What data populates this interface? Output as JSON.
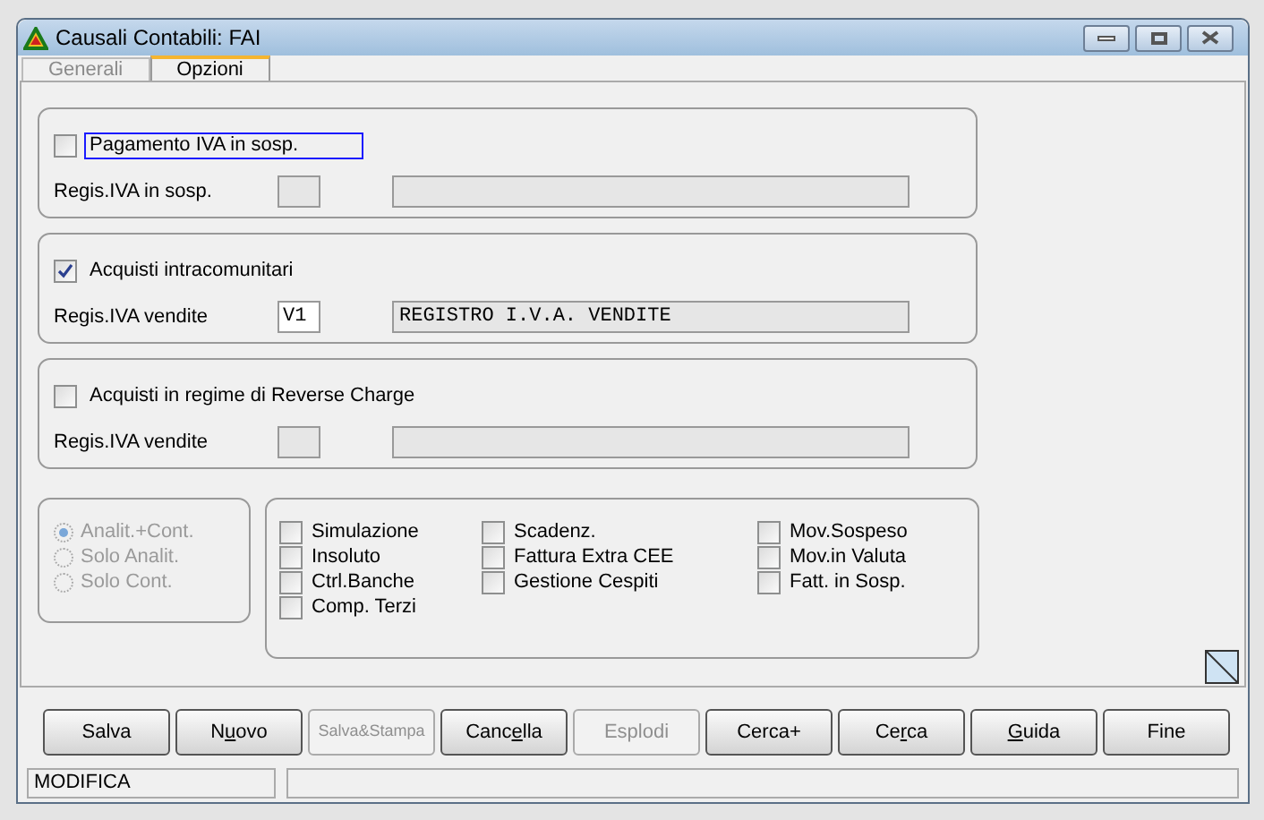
{
  "window": {
    "title": "Causali Contabili: FAI"
  },
  "tabs": [
    {
      "label": "Generali",
      "selected": false
    },
    {
      "label": "Opzioni",
      "selected": true
    }
  ],
  "sections": [
    {
      "option": {
        "label": "Pagamento IVA in sosp.",
        "checked": false,
        "focused": true
      },
      "register": {
        "label": "Regis.IVA in sosp.",
        "enabled": false
      }
    },
    {
      "option": {
        "label": "Acquisti intracomunitari",
        "checked": true,
        "focused": false
      },
      "register": {
        "label": "Regis.IVA vendite",
        "code": "V1",
        "description": "REGISTRO I.V.A. VENDITE",
        "enabled": true
      }
    },
    {
      "option": {
        "label": "Acquisti in regime di Reverse Charge",
        "checked": false,
        "focused": false
      },
      "register": {
        "label": "Regis.IVA vendite",
        "enabled": false
      }
    }
  ],
  "mode_radios": [
    {
      "label": "Analit.+Cont.",
      "selected": true,
      "disabled": true
    },
    {
      "label": "Solo Analit.",
      "selected": false,
      "disabled": true
    },
    {
      "label": "Solo Cont.",
      "selected": false,
      "disabled": true
    }
  ],
  "flag_columns": [
    [
      {
        "label": "Simulazione",
        "checked": false
      },
      {
        "label": "Insoluto",
        "checked": false
      },
      {
        "label": "Ctrl.Banche",
        "checked": false
      },
      {
        "label": "Comp. Terzi",
        "checked": false
      }
    ],
    [
      {
        "label": "Scadenz.",
        "checked": false
      },
      {
        "label": "Fattura Extra CEE",
        "checked": false
      },
      {
        "label": "Gestione Cespiti",
        "checked": false
      }
    ],
    [
      {
        "label": "Mov.Sospeso",
        "checked": false
      },
      {
        "label": "Mov.in Valuta",
        "checked": false
      },
      {
        "label": "Fatt. in Sosp.",
        "checked": false
      }
    ]
  ],
  "buttons": [
    {
      "label": [
        {
          "text": "Salva",
          "underlined": false
        }
      ],
      "disabled": false,
      "small": false
    },
    {
      "label": [
        {
          "text": "N",
          "underlined": false
        },
        {
          "text": "u",
          "underlined": true
        },
        {
          "text": "ovo",
          "underlined": false
        }
      ],
      "disabled": false,
      "small": false
    },
    {
      "label": [
        {
          "text": "Salva&Stampa",
          "underlined": false
        }
      ],
      "disabled": true,
      "small": true
    },
    {
      "label": [
        {
          "text": "Canc",
          "underlined": false
        },
        {
          "text": "e",
          "underlined": true
        },
        {
          "text": "lla",
          "underlined": false
        }
      ],
      "disabled": false,
      "small": false
    },
    {
      "label": [
        {
          "text": "Esplodi",
          "underlined": false
        }
      ],
      "disabled": true,
      "small": false
    },
    {
      "label": [
        {
          "text": "Cerca+",
          "underlined": false
        }
      ],
      "disabled": false,
      "small": false
    },
    {
      "label": [
        {
          "text": "Ce",
          "underlined": false
        },
        {
          "text": "r",
          "underlined": true
        },
        {
          "text": "ca",
          "underlined": false
        }
      ],
      "disabled": false,
      "small": false
    },
    {
      "label": [
        {
          "text": "G",
          "underlined": true
        },
        {
          "text": "uida",
          "underlined": false
        }
      ],
      "disabled": false,
      "small": false
    },
    {
      "label": [
        {
          "text": "Fine",
          "underlined": false
        }
      ],
      "disabled": false,
      "small": false
    }
  ],
  "status_bar": {
    "mode": "MODIFICA"
  }
}
